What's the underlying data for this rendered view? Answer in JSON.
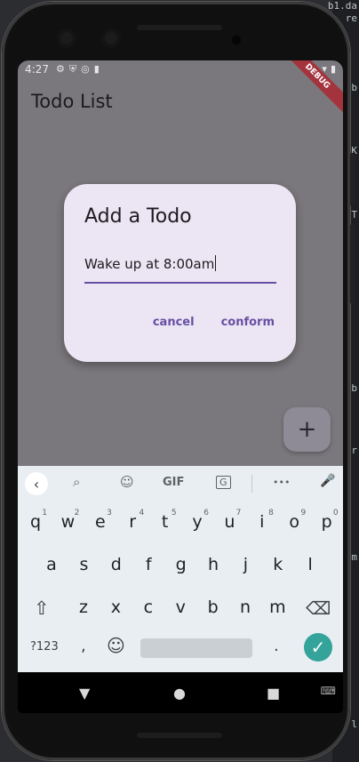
{
  "editor_fragments": [
    "b1.da",
    "re",
    "b",
    "K",
    "T",
    "b",
    "r",
    "m",
    "l"
  ],
  "status_bar": {
    "time": "4:27",
    "debug_label": "DEBUG"
  },
  "app": {
    "title": "Todo List",
    "fab_label": "+"
  },
  "dialog": {
    "title": "Add a Todo",
    "input_value": "Wake up at 8:00am",
    "cancel_label": "cancel",
    "confirm_label": "conform",
    "accent_color": "#6750a4"
  },
  "keyboard": {
    "toolbar": {
      "back": "‹",
      "search": "⌕",
      "sticker": "☺",
      "gif": "GIF",
      "translate": "G",
      "more": "•••",
      "mic": "🎤"
    },
    "row1": [
      "q",
      "w",
      "e",
      "r",
      "t",
      "y",
      "u",
      "i",
      "o",
      "p"
    ],
    "row1_hints": [
      "1",
      "2",
      "3",
      "4",
      "5",
      "6",
      "7",
      "8",
      "9",
      "0"
    ],
    "row2": [
      "a",
      "s",
      "d",
      "f",
      "g",
      "h",
      "j",
      "k",
      "l"
    ],
    "row3": [
      "z",
      "x",
      "c",
      "v",
      "b",
      "n",
      "m"
    ],
    "shift": "⇧",
    "backspace": "⌫",
    "symbols": "?123",
    "comma": ",",
    "emoji": "☺",
    "period": ".",
    "enter": "✓"
  },
  "navbar": {
    "back": "▼",
    "home": "●",
    "recents": "■",
    "keyboard_switch": "⌨"
  }
}
